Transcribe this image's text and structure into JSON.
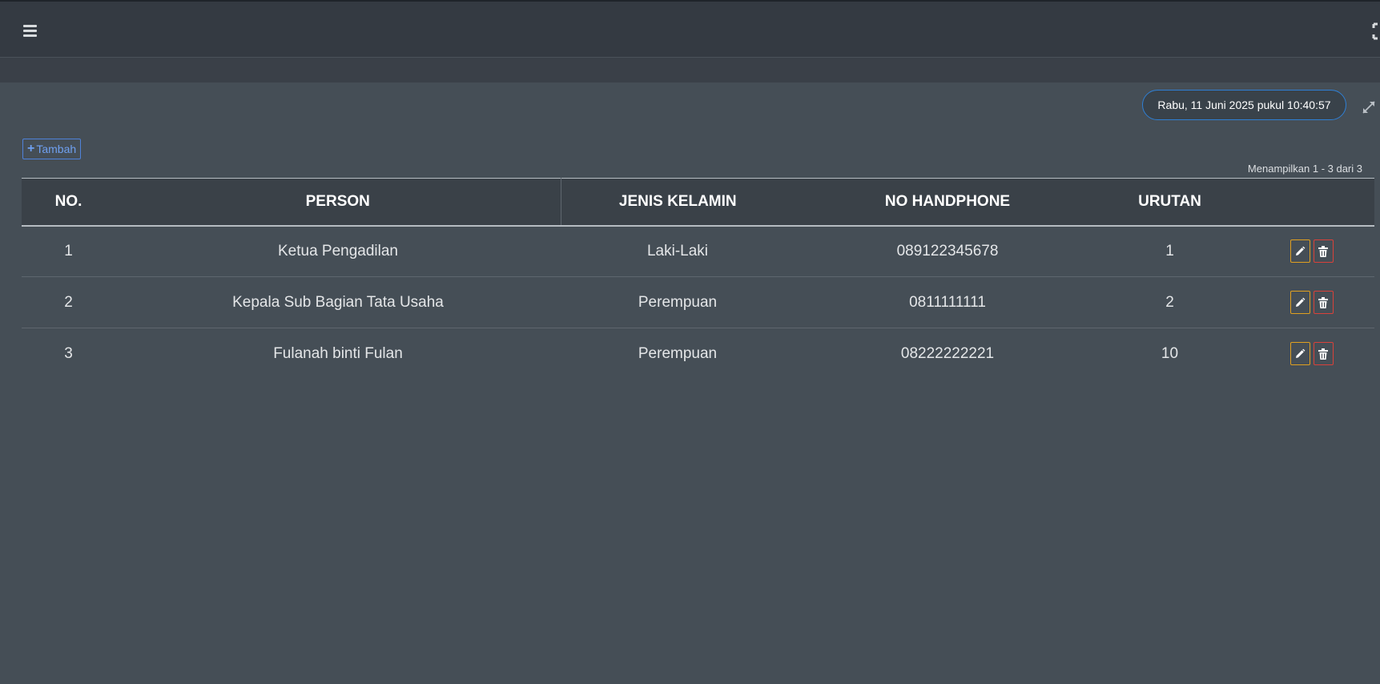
{
  "header": {
    "menu_icon": "hamburger-icon",
    "fullscreen_icon": "fullscreen-icon"
  },
  "datetime": "Rabu, 11 Juni 2025 pukul 10:40:57",
  "toolbar": {
    "add_label": "Tambah",
    "add_icon": "plus-icon",
    "expand_icon": "expand-icon"
  },
  "paging_info": "Menampilkan 1 - 3 dari 3",
  "table": {
    "columns": [
      "NO.",
      "PERSON",
      "JENIS KELAMIN",
      "NO HANDPHONE",
      "URUTAN",
      ""
    ],
    "rows": [
      {
        "no": "1",
        "person": "Ketua Pengadilan",
        "gender": "Laki-Laki",
        "phone": "089122345678",
        "order": "1"
      },
      {
        "no": "2",
        "person": "Kepala Sub Bagian Tata Usaha",
        "gender": "Perempuan",
        "phone": "0811111111",
        "order": "2"
      },
      {
        "no": "3",
        "person": "Fulanah binti Fulan",
        "gender": "Perempuan",
        "phone": "08222222221",
        "order": "10"
      }
    ],
    "row_actions": {
      "edit_icon": "pencil-icon",
      "delete_icon": "trash-icon"
    }
  },
  "colors": {
    "background": "#454e56",
    "topbar": "#343a42",
    "accent_blue": "#2f7fd4",
    "edit_border": "#e0a020",
    "delete_border": "#d9413a"
  }
}
